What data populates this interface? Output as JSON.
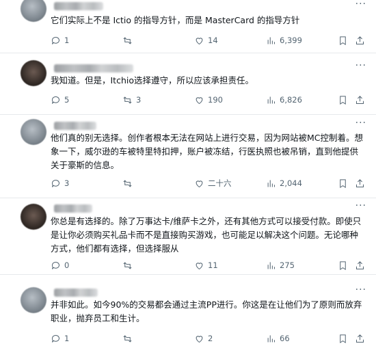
{
  "replies": [
    {
      "text": "它们实际上不是 Ictio 的指导方针，而是 MasterCard 的指导方针",
      "replies": "1",
      "reposts": "",
      "likes": "14",
      "views": "6,399"
    },
    {
      "text": "我知道。但是，Itchio选择遵守，所以应该承担责任。",
      "replies": "5",
      "reposts": "3",
      "likes": "190",
      "views": "6,826"
    },
    {
      "text": "他们真的别无选择。创作者根本无法在网站上进行交易，因为网站被MC控制着。想象一下，威尔逊的车被特里特扣押，账户被冻结，行医执照也被吊销，直到他提供关于豪斯的信息。",
      "replies": "3",
      "reposts": "",
      "likes": "二十六",
      "views": "2,044"
    },
    {
      "text": "你总是有选择的。除了万事达卡/维萨卡之外，还有其他方式可以接受付款。即使只是让你必须购买礼品卡而不是直接购买游戏，也可能足以解决这个问题。无论哪种方式，他们都有选择，但选择服从",
      "replies": "0",
      "reposts": "",
      "likes": "11",
      "views": "275"
    },
    {
      "text": "并非如此。如今90%的交易都会通过主流PP进行。你这是在让他们为了原则而放弃职业，抛弃员工和生计。",
      "replies": "1",
      "reposts": "",
      "likes": "2",
      "views": "66"
    }
  ],
  "icons": [
    "reply-icon",
    "repost-icon",
    "like-icon",
    "views-icon",
    "bookmark-icon",
    "share-icon",
    "more-icon"
  ],
  "colors": {
    "text": "#0f1419",
    "muted": "#536471",
    "divider": "#e6e9ec"
  }
}
